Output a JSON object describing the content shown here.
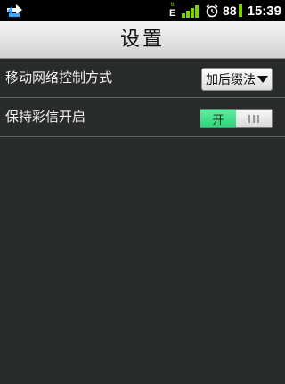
{
  "status_bar": {
    "network_type": "E",
    "battery_level": "88",
    "time": "15:39",
    "icons": [
      "usb-sync-icon",
      "data-transfer-icon",
      "signal-strength-icon",
      "alarm-clock-icon",
      "battery-icon"
    ],
    "accent_color": "#7fd000"
  },
  "title_bar": {
    "title": "设置"
  },
  "settings": {
    "network_control": {
      "label": "移动网络控制方式",
      "selected": "加后缀法"
    },
    "keep_mms": {
      "label": "保持彩信开启",
      "toggle_on_label": "开",
      "state": "on",
      "on_color": "#3fe08a"
    }
  }
}
